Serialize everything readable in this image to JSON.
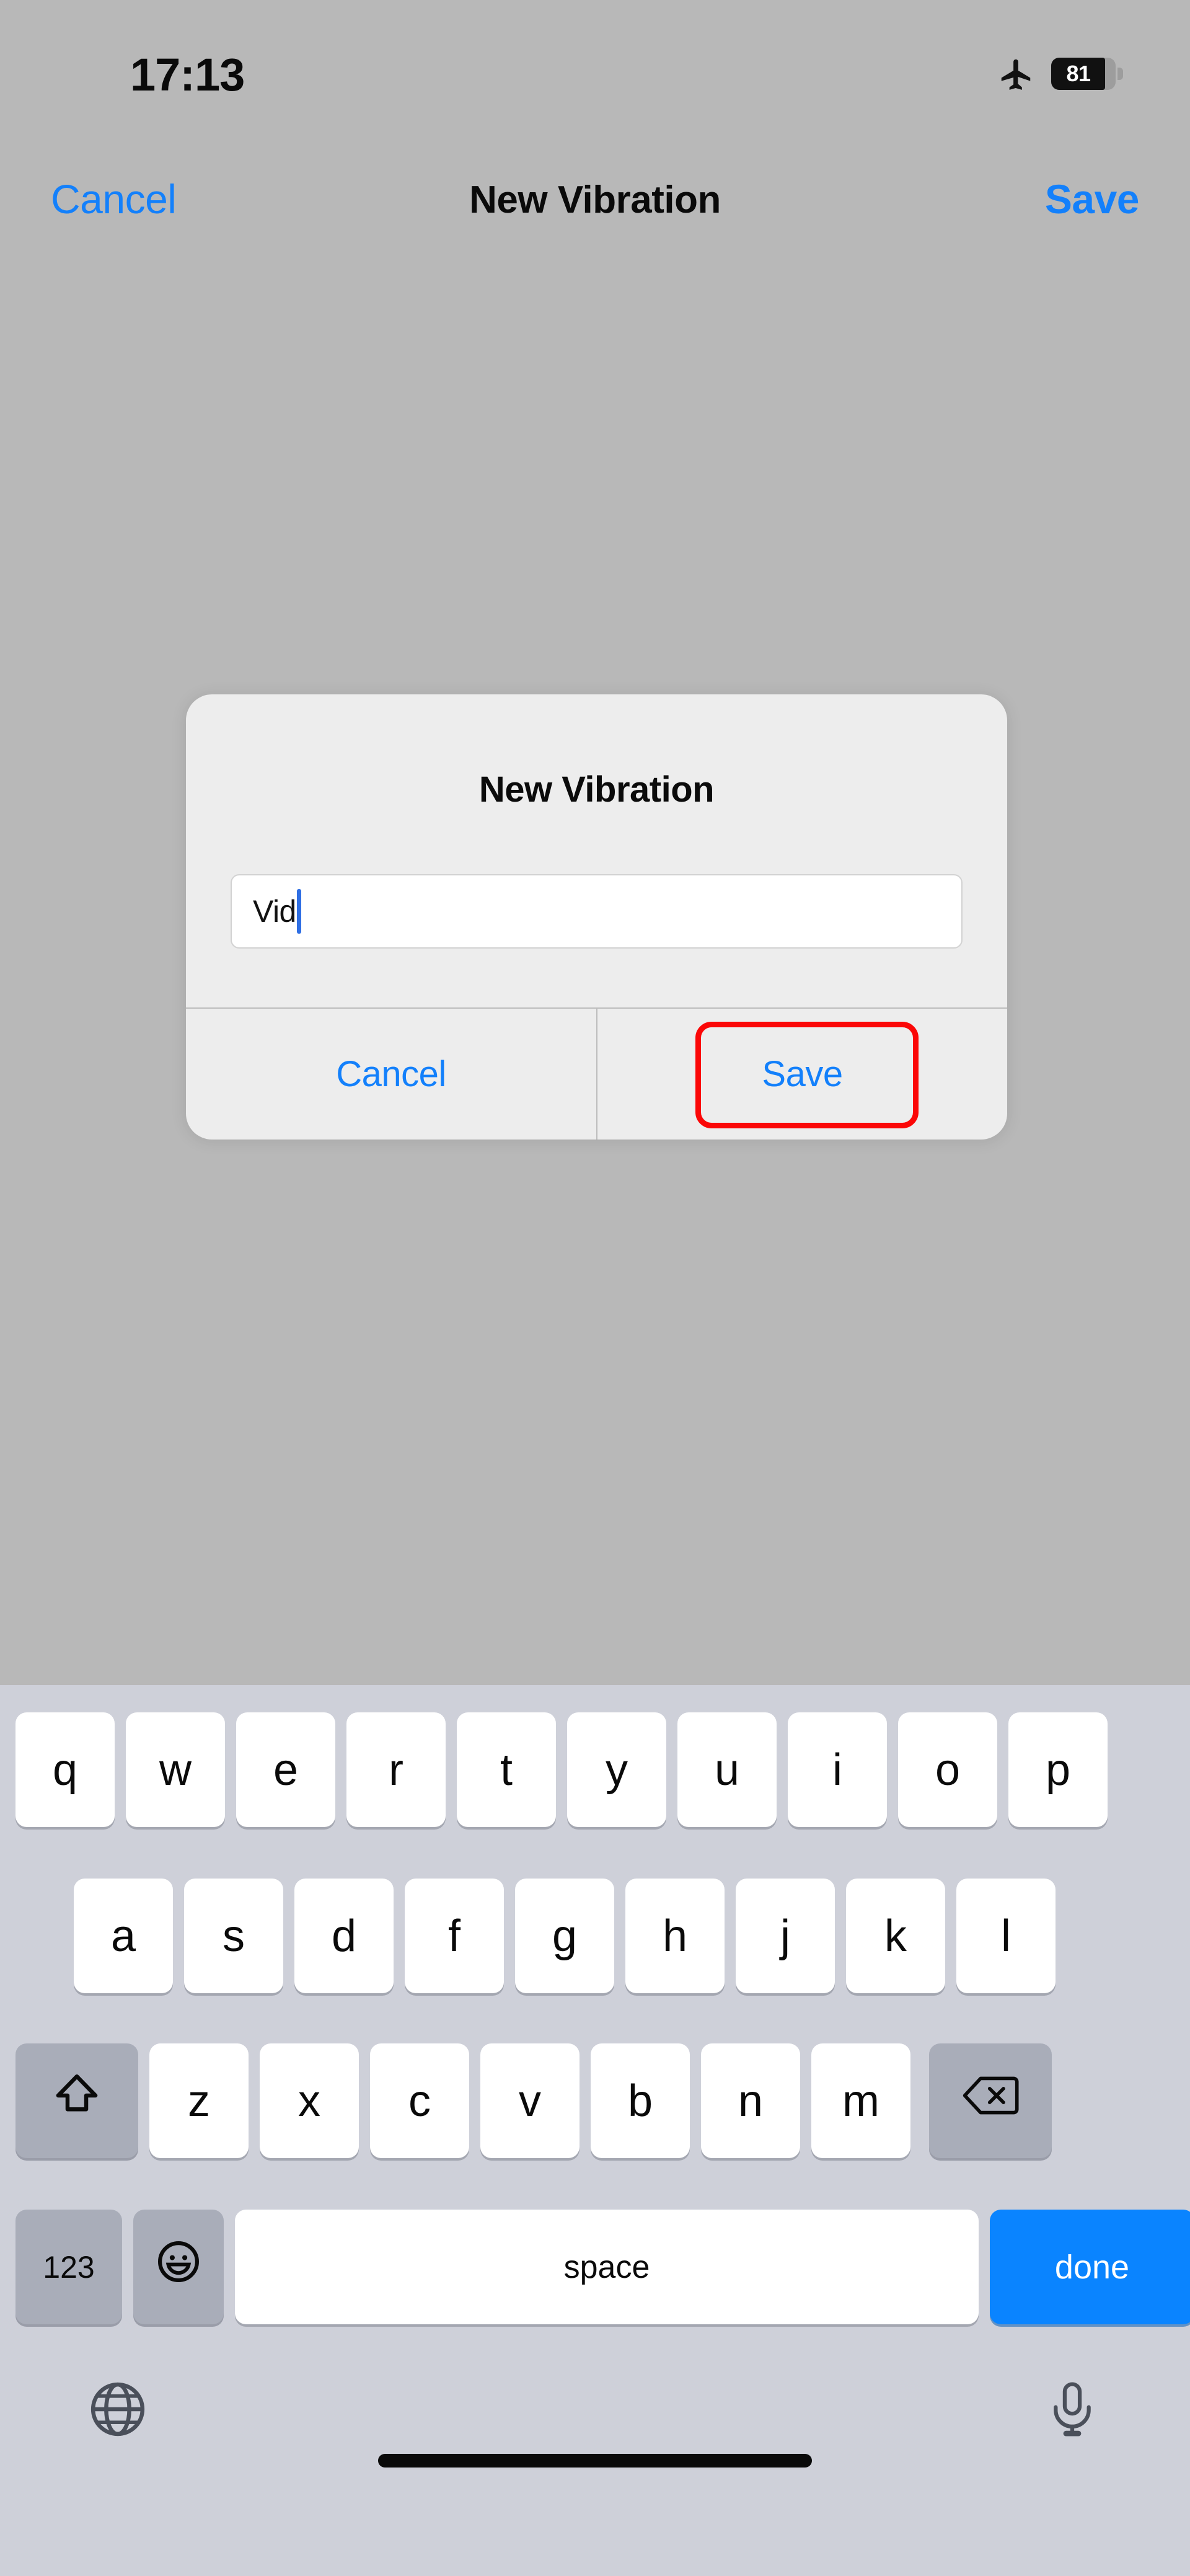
{
  "status_bar": {
    "time": "17:13",
    "airplane_icon": "airplane-mode-icon",
    "battery_percent": "81",
    "battery_icon": "battery-icon"
  },
  "nav_bar": {
    "cancel_label": "Cancel",
    "title": "New Vibration",
    "save_label": "Save"
  },
  "alert": {
    "title": "New Vibration",
    "text_field_value": "Vid",
    "text_field_placeholder": "",
    "cancel_label": "Cancel",
    "save_label": "Save",
    "highlight_color": "#fb0707",
    "highlight_target": "save-button"
  },
  "keyboard": {
    "row1": [
      "q",
      "w",
      "e",
      "r",
      "t",
      "y",
      "u",
      "i",
      "o",
      "p"
    ],
    "row2": [
      "a",
      "s",
      "d",
      "f",
      "g",
      "h",
      "j",
      "k",
      "l"
    ],
    "row3_letters": [
      "z",
      "x",
      "c",
      "v",
      "b",
      "n",
      "m"
    ],
    "shift_icon": "shift-icon",
    "backspace_icon": "backspace-icon",
    "mode_label": "123",
    "emoji_icon": "emoji-icon",
    "space_label": "space",
    "done_label": "done",
    "globe_icon": "globe-icon",
    "microphone_icon": "microphone-icon"
  },
  "colors": {
    "accent_blue": "#1380fb",
    "keyboard_bg": "#ced0d9",
    "screen_bg": "#b8b8b8",
    "dialog_bg": "#ededed",
    "done_key_blue": "#0a84ff"
  }
}
